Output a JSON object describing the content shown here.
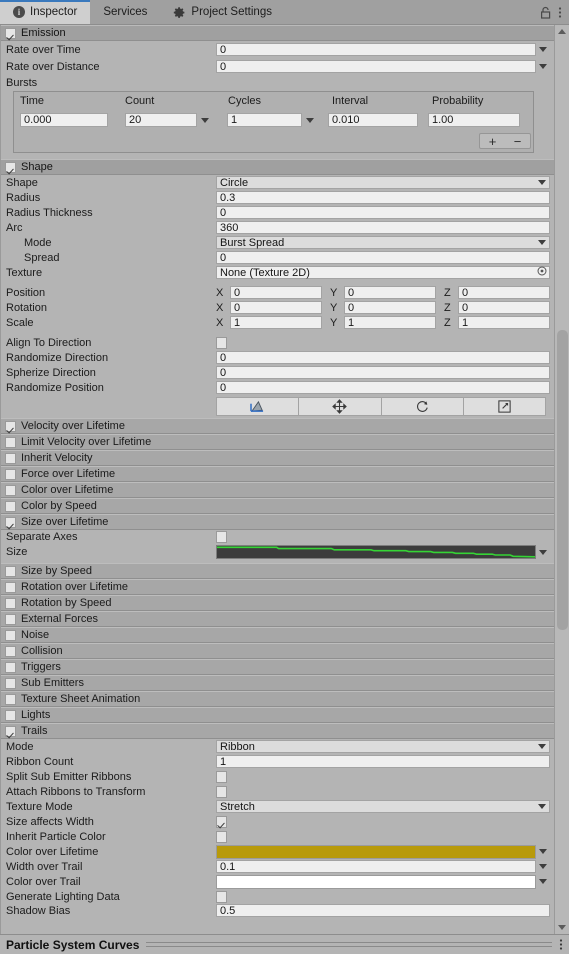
{
  "window": {
    "tabs": [
      {
        "label": "Inspector",
        "icon": "info-icon",
        "active": true
      },
      {
        "label": "Services",
        "icon": "none",
        "active": false
      },
      {
        "label": "Project Settings",
        "icon": "gear-icon",
        "active": false
      }
    ],
    "lock_icon": "lock-icon",
    "menu_icon": "kebab-menu-icon"
  },
  "emission": {
    "header": "Emission",
    "enabled": true,
    "rate_over_time_label": "Rate over Time",
    "rate_over_time_value": "0",
    "rate_over_distance_label": "Rate over Distance",
    "rate_over_distance_value": "0",
    "bursts_label": "Bursts",
    "burst_columns": [
      "Time",
      "Count",
      "Cycles",
      "Interval",
      "Probability"
    ],
    "burst_rows": [
      {
        "time": "0.000",
        "count": "20",
        "cycles": "1",
        "interval": "0.010",
        "probability": "1.00"
      }
    ],
    "add_label": "+",
    "remove_label": "−"
  },
  "shape": {
    "header": "Shape",
    "enabled": true,
    "fields": [
      {
        "label": "Shape",
        "value": "Circle",
        "type": "dropdown",
        "indent": false
      },
      {
        "label": "Radius",
        "value": "0.3",
        "type": "text",
        "indent": false
      },
      {
        "label": "Radius Thickness",
        "value": "0",
        "type": "text",
        "indent": false
      },
      {
        "label": "Arc",
        "value": "360",
        "type": "text",
        "indent": false
      },
      {
        "label": "Mode",
        "value": "Burst Spread",
        "type": "dropdown",
        "indent": true
      },
      {
        "label": "Spread",
        "value": "0",
        "type": "text",
        "indent": true
      },
      {
        "label": "Texture",
        "value": "None (Texture 2D)",
        "type": "object",
        "indent": false
      }
    ],
    "vectors": [
      {
        "label": "Position",
        "x": "0",
        "y": "0",
        "z": "0"
      },
      {
        "label": "Rotation",
        "x": "0",
        "y": "0",
        "z": "0"
      },
      {
        "label": "Scale",
        "x": "1",
        "y": "1",
        "z": "1"
      }
    ],
    "align_to_direction_label": "Align To Direction",
    "align_to_direction_checked": false,
    "scalars": [
      {
        "label": "Randomize Direction",
        "value": "0"
      },
      {
        "label": "Spherize Direction",
        "value": "0"
      },
      {
        "label": "Randomize Position",
        "value": "0"
      }
    ],
    "tools": [
      "edit-shape-icon",
      "move-tool-icon",
      "rotate-tool-icon",
      "scale-tool-icon"
    ],
    "axis_x": "X",
    "axis_y": "Y",
    "axis_z": "Z"
  },
  "modules": [
    {
      "label": "Velocity over Lifetime",
      "enabled": true
    },
    {
      "label": "Limit Velocity over Lifetime",
      "enabled": false
    },
    {
      "label": "Inherit Velocity",
      "enabled": false
    },
    {
      "label": "Force over Lifetime",
      "enabled": false
    },
    {
      "label": "Color over Lifetime",
      "enabled": false
    },
    {
      "label": "Color by Speed",
      "enabled": false
    },
    {
      "label": "Size over Lifetime",
      "enabled": true
    }
  ],
  "size_over_lifetime": {
    "separate_axes_label": "Separate Axes",
    "separate_axes_checked": false,
    "size_label": "Size",
    "curve_color": "#35d435",
    "curve_bg": "#3c3c3c"
  },
  "modules2": [
    {
      "label": "Size by Speed",
      "enabled": false
    },
    {
      "label": "Rotation over Lifetime",
      "enabled": false
    },
    {
      "label": "Rotation by Speed",
      "enabled": false
    },
    {
      "label": "External Forces",
      "enabled": false
    },
    {
      "label": "Noise",
      "enabled": false
    },
    {
      "label": "Collision",
      "enabled": false
    },
    {
      "label": "Triggers",
      "enabled": false
    },
    {
      "label": "Sub Emitters",
      "enabled": false
    },
    {
      "label": "Texture Sheet Animation",
      "enabled": false
    },
    {
      "label": "Lights",
      "enabled": false
    },
    {
      "label": "Trails",
      "enabled": true
    }
  ],
  "trails": {
    "rows": [
      {
        "label": "Mode",
        "value": "Ribbon",
        "type": "dropdown"
      },
      {
        "label": "Ribbon Count",
        "value": "1",
        "type": "text"
      },
      {
        "label": "Split Sub Emitter Ribbons",
        "value": "",
        "type": "checkbox",
        "checked": false
      },
      {
        "label": "Attach Ribbons to Transform",
        "value": "",
        "type": "checkbox",
        "checked": false
      },
      {
        "label": "Texture Mode",
        "value": "Stretch",
        "type": "dropdown"
      },
      {
        "label": "Size affects Width",
        "value": "",
        "type": "checkbox",
        "checked": true
      },
      {
        "label": "Inherit Particle Color",
        "value": "",
        "type": "checkbox",
        "checked": false
      },
      {
        "label": "Color over Lifetime",
        "value": "",
        "type": "gradient",
        "color": "#b89a0a"
      },
      {
        "label": "Width over Trail",
        "value": "0.1",
        "type": "text-caret"
      },
      {
        "label": "Color over Trail",
        "value": "",
        "type": "gradient",
        "color": "#ffffff"
      },
      {
        "label": "Generate Lighting Data",
        "value": "",
        "type": "checkbox",
        "checked": false
      },
      {
        "label": "Shadow Bias",
        "value": "0.5",
        "type": "text"
      }
    ]
  },
  "footer": {
    "title": "Particle System Curves",
    "menu_icon": "kebab-menu-icon"
  }
}
